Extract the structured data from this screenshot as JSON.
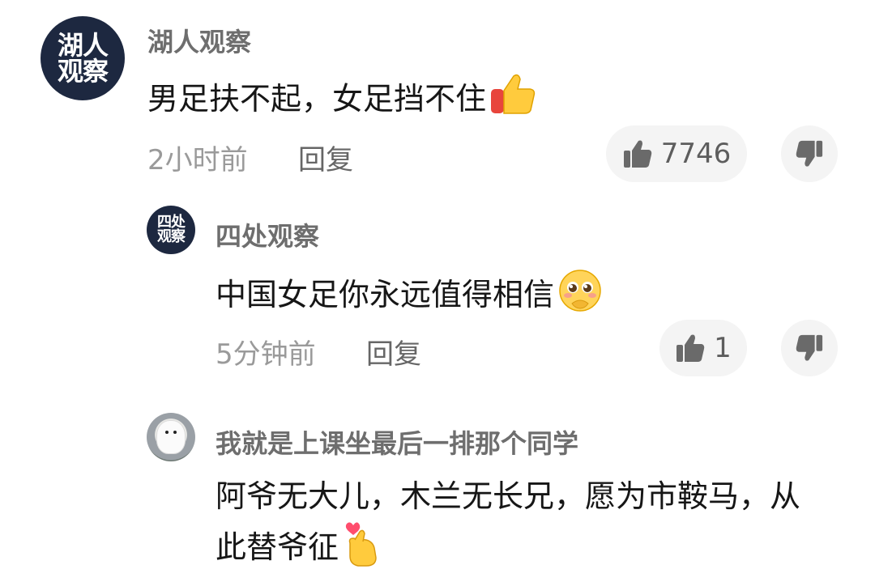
{
  "comments": [
    {
      "avatar_text": [
        "湖人",
        "观察"
      ],
      "username": "湖人观察",
      "content": "男足扶不起，女足挡不住",
      "emoji": "thumbs-up-icon",
      "time": "2小时前",
      "reply_label": "回复",
      "like_count": "7746"
    },
    {
      "avatar_text": [
        "四处",
        "观察"
      ],
      "username": "四处观察",
      "content": "中国女足你永远值得相信",
      "emoji": "pleading-face-icon",
      "time": "5分钟前",
      "reply_label": "回复",
      "like_count": "1"
    },
    {
      "avatar_icon": "samoyed-dog-photo",
      "username": "我就是上课坐最后一排那个同学",
      "content": "阿爷无大儿，木兰无长兄，愿为市鞍马，从此替爷征",
      "emoji": "finger-heart-icon"
    }
  ],
  "colors": {
    "avatar_badge_bg": "#1d2840",
    "username": "#6e6e6e",
    "content": "#161616",
    "meta": "#9a9a9a",
    "pill_bg": "#f4f4f4"
  }
}
